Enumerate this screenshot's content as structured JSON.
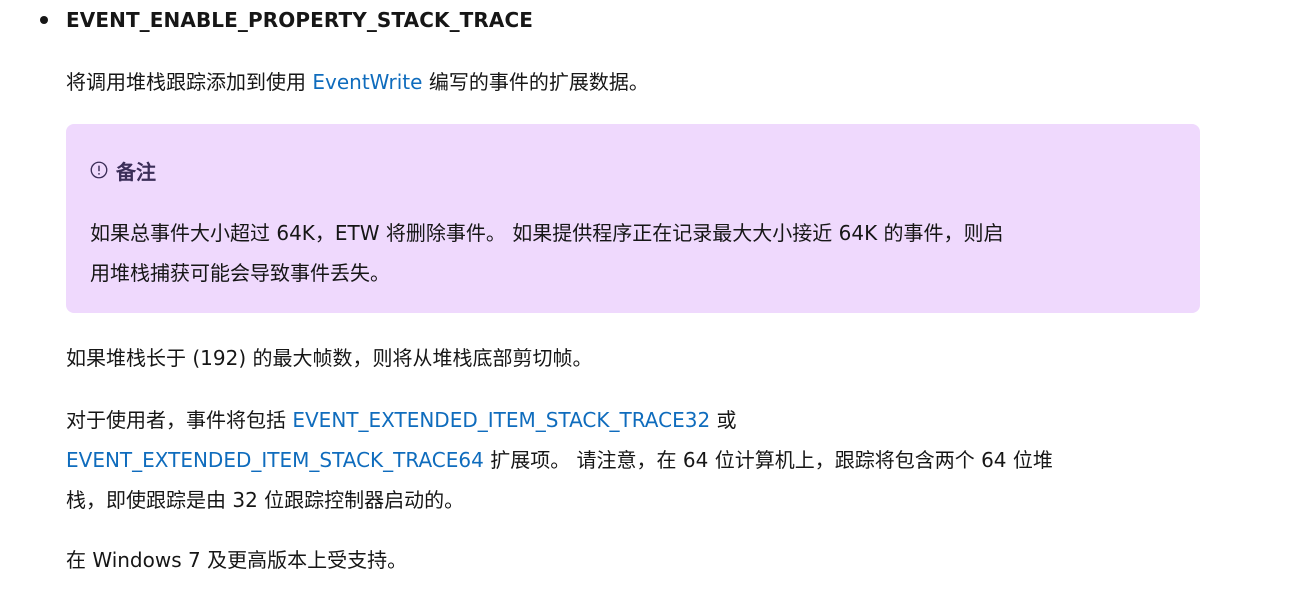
{
  "heading_term": "EVENT_ENABLE_PROPERTY_STACK_TRACE",
  "intro": {
    "before": "将调用堆栈跟踪添加到使用 ",
    "link": "EventWrite",
    "after": " 编写的事件的扩展数据。"
  },
  "note": {
    "icon": "info-circle-icon",
    "title": "备注",
    "line1": "如果总事件大小超过 64K，ETW 将删除事件。 如果提供程序正在记录最大大小接近 64K 的事件，则启",
    "line2": "用堆栈捕获可能会导致事件丢失。"
  },
  "para_frames": "如果堆栈长于 (192) 的最大帧数，则将从堆栈底部剪切帧。",
  "para_consumer": {
    "before": "对于使用者，事件将包括 ",
    "link1": "EVENT_EXTENDED_ITEM_STACK_TRACE32",
    "mid": " 或",
    "link2": "EVENT_EXTENDED_ITEM_STACK_TRACE64",
    "after": " 扩展项。 请注意，在 64 位计算机上，跟踪将包含两个 64 位堆",
    "line3": "栈，即使跟踪是由 32 位跟踪控制器启动的。"
  },
  "para_support": "在 Windows 7 及更高版本上受支持。",
  "colors": {
    "link": "#0f6cbd",
    "note_background": "#efd9fd",
    "note_title": "#3b2e58",
    "text": "#161616"
  }
}
